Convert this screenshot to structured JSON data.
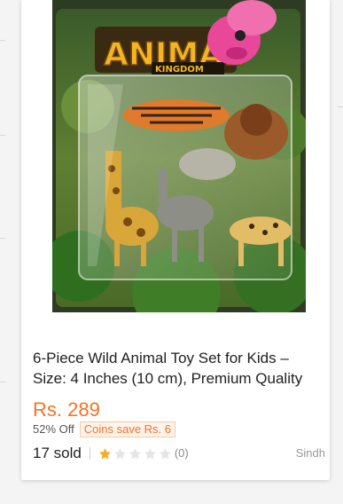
{
  "product": {
    "title": "6-Piece Wild Animal Toy Set for Kids – Size: 4 Inches (10 cm), Premium Quality",
    "price": "Rs. 289",
    "discount": "52% Off",
    "coins": "Coins save Rs. 6",
    "sold": "17 sold",
    "rating_value": 1,
    "rating_max": 5,
    "rating_count": "(0)",
    "location": "Sindh",
    "image": {
      "package_title": "ANIMAL",
      "package_subtitle": "KINGDOM",
      "alt_icon": "animal-toy-package-image"
    }
  },
  "colors": {
    "price": "#f57224",
    "star_filled": "#f6b01e",
    "star_empty": "#e5e5e5"
  }
}
